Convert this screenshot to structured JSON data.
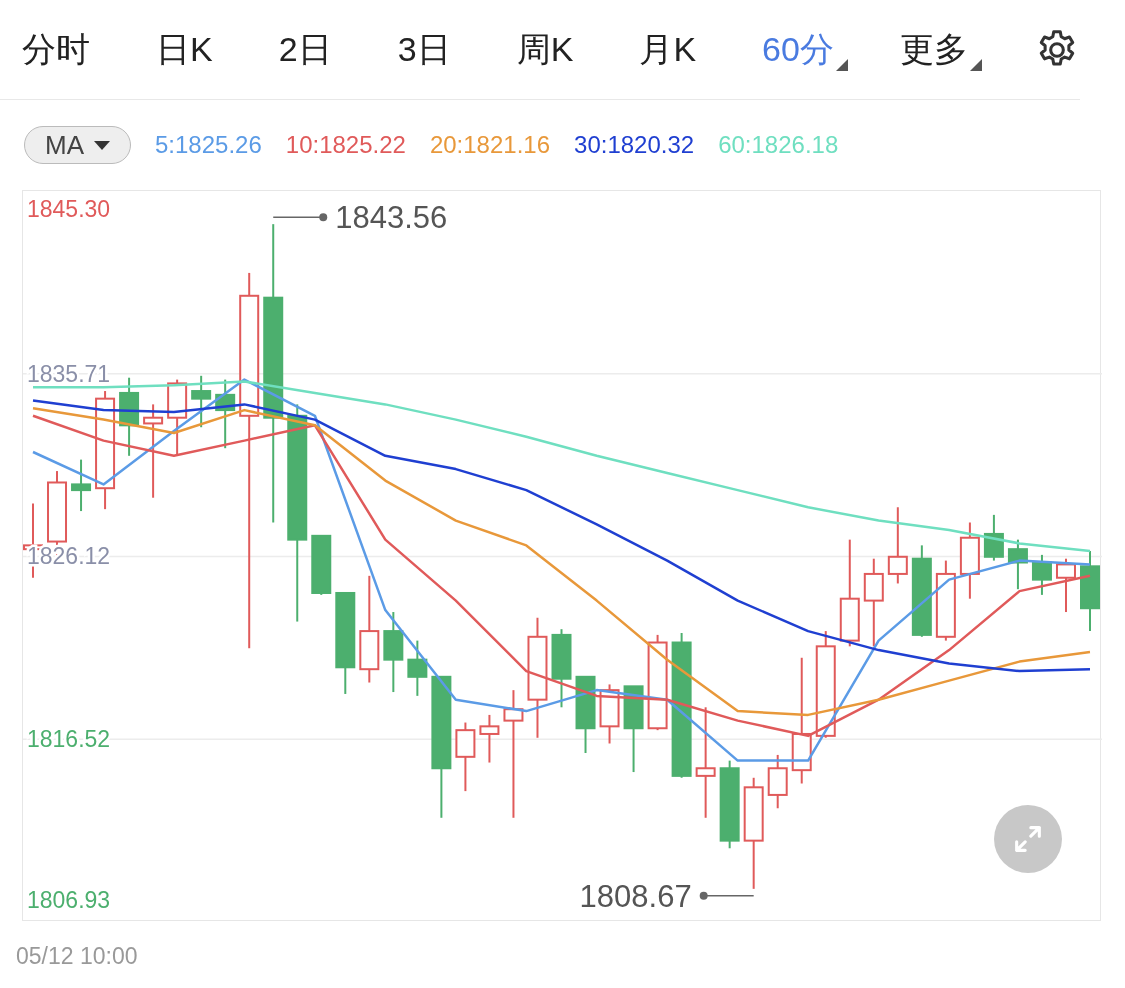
{
  "tabs": [
    {
      "label": "分时",
      "selected": false,
      "has_menu": false
    },
    {
      "label": "日K",
      "selected": false,
      "has_menu": false
    },
    {
      "label": "2日",
      "selected": false,
      "has_menu": false
    },
    {
      "label": "3日",
      "selected": false,
      "has_menu": false
    },
    {
      "label": "周K",
      "selected": false,
      "has_menu": false
    },
    {
      "label": "月K",
      "selected": false,
      "has_menu": false
    },
    {
      "label": "60分",
      "selected": true,
      "has_menu": true
    },
    {
      "label": "更多",
      "selected": false,
      "has_menu": true
    }
  ],
  "indicator_select": {
    "value": "MA"
  },
  "legend": [
    {
      "label": "5:1825.26",
      "color": "#5b9be6"
    },
    {
      "label": "10:1825.22",
      "color": "#e05a5a"
    },
    {
      "label": "20:1821.16",
      "color": "#e8983a"
    },
    {
      "label": "30:1820.32",
      "color": "#1f3fd1"
    },
    {
      "label": "60:1826.18",
      "color": "#6fdfc0"
    }
  ],
  "chart": {
    "chart_data": {
      "type": "line",
      "ylim": [
        1806.93,
        1845.3
      ],
      "yticks": [
        {
          "value": 1845.3,
          "label": "1845.30"
        },
        {
          "value": 1835.71,
          "label": "1835.71"
        },
        {
          "value": 1826.12,
          "label": "1826.12"
        },
        {
          "value": 1816.52,
          "label": "1816.52"
        },
        {
          "value": 1806.93,
          "label": "1806.93"
        }
      ],
      "categories": [
        null,
        null,
        null,
        null,
        null,
        null,
        null,
        null,
        null,
        null,
        null,
        null,
        null,
        null,
        null,
        null
      ],
      "series": [
        {
          "color": "#5b9be6",
          "values": [
            1831.6,
            1829.9,
            1832.7,
            1835.4,
            1833.5,
            1823.3,
            1818.6,
            1818.0,
            1819.1,
            1818.6,
            1815.4,
            1815.4,
            1821.7,
            1824.9,
            1825.9,
            1825.7
          ]
        },
        {
          "color": "#e05a5a",
          "values": [
            1833.5,
            1832.2,
            1831.4,
            1832.2,
            1833.0,
            1827.0,
            1823.8,
            1820.1,
            1818.8,
            1818.6,
            1817.5,
            1816.7,
            1818.6,
            1821.2,
            1824.3,
            1825.1
          ]
        },
        {
          "color": "#e8983a",
          "values": [
            1833.9,
            1833.3,
            1832.6,
            1833.8,
            1833.0,
            1830.1,
            1828.0,
            1826.7,
            1823.8,
            1820.7,
            1818.0,
            1817.8,
            1818.6,
            1819.6,
            1820.6,
            1821.1
          ]
        },
        {
          "color": "#1f3fd1",
          "values": [
            1834.3,
            1833.8,
            1833.7,
            1834.1,
            1833.3,
            1831.4,
            1830.7,
            1829.6,
            1827.8,
            1825.9,
            1823.8,
            1822.2,
            1821.2,
            1820.5,
            1820.1,
            1820.2
          ]
        },
        {
          "color": "#6fdfc0",
          "values": [
            1835.0,
            1835.0,
            1835.1,
            1835.3,
            1834.7,
            1834.1,
            1833.3,
            1832.4,
            1831.4,
            1830.5,
            1829.6,
            1828.7,
            1828.0,
            1827.5,
            1826.8,
            1826.4
          ]
        }
      ],
      "grid": true,
      "annotations": [
        "1843.56",
        "1808.67"
      ]
    },
    "time_label": "05/12 10:00"
  }
}
